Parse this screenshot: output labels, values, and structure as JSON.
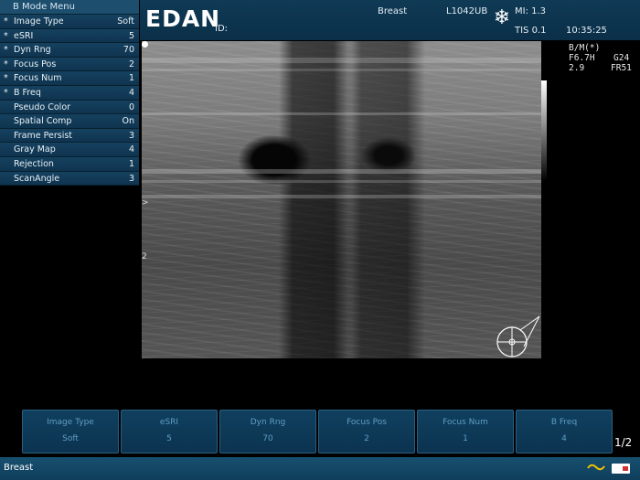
{
  "menu": {
    "title": "B Mode Menu",
    "items": [
      {
        "star": "*",
        "label": "Image Type",
        "value": "Soft"
      },
      {
        "star": "*",
        "label": "eSRI",
        "value": "5"
      },
      {
        "star": "*",
        "label": "Dyn Rng",
        "value": "70"
      },
      {
        "star": "*",
        "label": "Focus Pos",
        "value": "2"
      },
      {
        "star": "*",
        "label": "Focus Num",
        "value": "1"
      },
      {
        "star": "*",
        "label": "B Freq",
        "value": "4"
      },
      {
        "star": "",
        "label": "Pseudo Color",
        "value": "0"
      },
      {
        "star": "",
        "label": "Spatial Comp",
        "value": "On"
      },
      {
        "star": "",
        "label": "Frame Persist",
        "value": "3"
      },
      {
        "star": "",
        "label": "Gray Map",
        "value": "4"
      },
      {
        "star": "",
        "label": "Rejection",
        "value": "1"
      },
      {
        "star": "",
        "label": "ScanAngle",
        "value": "3"
      }
    ]
  },
  "header": {
    "logo": "EDAN",
    "id_label": "ID:",
    "exam": "Breast",
    "probe": "L1042UB",
    "mi": "MI: 1.3",
    "tis": "TIS 0.1",
    "time": "10:35:25"
  },
  "info": {
    "mode": "B/M(*)",
    "freq": "F6.7H",
    "gain": "G24",
    "depth": "2.9",
    "frame_rate": "FR51"
  },
  "depth_marks": {
    "mark2": "2",
    "focus": ">"
  },
  "softkeys": [
    {
      "label": "Image Type",
      "value": "Soft"
    },
    {
      "label": "eSRI",
      "value": "5"
    },
    {
      "label": "Dyn Rng",
      "value": "70"
    },
    {
      "label": "Focus Pos",
      "value": "2"
    },
    {
      "label": "Focus Num",
      "value": "1"
    },
    {
      "label": "B Freq",
      "value": "4"
    }
  ],
  "page_indicator": "1/2",
  "status": {
    "exam": "Breast"
  },
  "icons": {
    "freeze": "snowflake-icon",
    "probe": "probe-orientation-icon",
    "wave": "wave-icon",
    "battery": "battery-icon"
  }
}
